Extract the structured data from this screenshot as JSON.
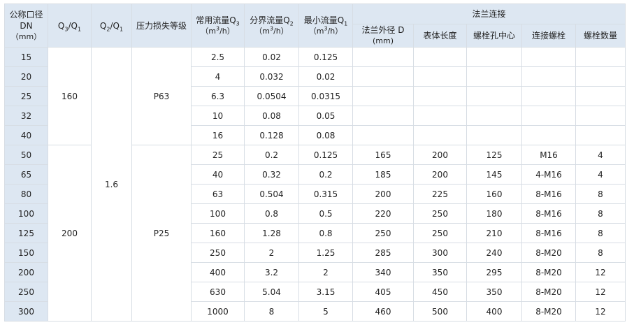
{
  "headers": {
    "dn": "公称口径",
    "dn_sub": "DN",
    "dn_unit": "（mm）",
    "q3q1_a": "Q",
    "q3q1_s1": "3",
    "q3q1_slash": "/Q",
    "q3q1_s2": "1",
    "q2q1_a": "Q",
    "q2q1_s1": "2",
    "q2q1_slash": "/Q",
    "q2q1_s2": "1",
    "pressure_loss": "压力损失等级",
    "q3_label": "常用流量Q",
    "q3_sub": "3",
    "q2_label": "分界流量Q",
    "q2_sub": "2",
    "q1_label": "最小流量Q",
    "q1_sub": "1",
    "flow_unit_pre": "（m",
    "flow_unit_sup": "3",
    "flow_unit_post": "/h）",
    "flange_group": "法兰连接",
    "flange_od": "法兰外径 D",
    "flange_od_unit": "(mm)",
    "body_length": "表体长度",
    "bolt_hole_center": "螺栓孔中心",
    "bolt": "连接螺栓",
    "bolt_count": "螺栓数量"
  },
  "merged": {
    "q3q1_p63": "160",
    "q3q1_p25": "200",
    "q2q1_all": "1.6",
    "loss_p63": "P63",
    "loss_p25": "P25"
  },
  "rows": [
    {
      "dn": "15",
      "q3": "2.5",
      "q2": "0.02",
      "q1": "0.125",
      "od": "",
      "len": "",
      "center": "",
      "bolt": "",
      "count": ""
    },
    {
      "dn": "20",
      "q3": "4",
      "q2": "0.032",
      "q1": "0.02",
      "od": "",
      "len": "",
      "center": "",
      "bolt": "",
      "count": ""
    },
    {
      "dn": "25",
      "q3": "6.3",
      "q2": "0.0504",
      "q1": "0.0315",
      "od": "",
      "len": "",
      "center": "",
      "bolt": "",
      "count": ""
    },
    {
      "dn": "32",
      "q3": "10",
      "q2": "0.08",
      "q1": "0.05",
      "od": "",
      "len": "",
      "center": "",
      "bolt": "",
      "count": ""
    },
    {
      "dn": "40",
      "q3": "16",
      "q2": "0.128",
      "q1": "0.08",
      "od": "",
      "len": "",
      "center": "",
      "bolt": "",
      "count": ""
    },
    {
      "dn": "50",
      "q3": "25",
      "q2": "0.2",
      "q1": "0.125",
      "od": "165",
      "len": "200",
      "center": "125",
      "bolt": "M16",
      "count": "4"
    },
    {
      "dn": "65",
      "q3": "40",
      "q2": "0.32",
      "q1": "0.2",
      "od": "185",
      "len": "200",
      "center": "145",
      "bolt": "4-M16",
      "count": "4"
    },
    {
      "dn": "80",
      "q3": "63",
      "q2": "0.504",
      "q1": "0.315",
      "od": "200",
      "len": "225",
      "center": "160",
      "bolt": "8-M16",
      "count": "8"
    },
    {
      "dn": "100",
      "q3": "100",
      "q2": "0.8",
      "q1": "0.5",
      "od": "220",
      "len": "250",
      "center": "180",
      "bolt": "8-M16",
      "count": "8"
    },
    {
      "dn": "125",
      "q3": "160",
      "q2": "1.28",
      "q1": "0.8",
      "od": "250",
      "len": "250",
      "center": "210",
      "bolt": "8-M16",
      "count": "8"
    },
    {
      "dn": "150",
      "q3": "250",
      "q2": "2",
      "q1": "1.25",
      "od": "285",
      "len": "300",
      "center": "240",
      "bolt": "8-M20",
      "count": "8"
    },
    {
      "dn": "200",
      "q3": "400",
      "q2": "3.2",
      "q1": "2",
      "od": "340",
      "len": "350",
      "center": "295",
      "bolt": "8-M20",
      "count": "12"
    },
    {
      "dn": "250",
      "q3": "630",
      "q2": "5.04",
      "q1": "3.15",
      "od": "405",
      "len": "450",
      "center": "350",
      "bolt": "8-M20",
      "count": "12"
    },
    {
      "dn": "300",
      "q3": "1000",
      "q2": "8",
      "q1": "5",
      "od": "460",
      "len": "500",
      "center": "400",
      "bolt": "8-M20",
      "count": "12"
    }
  ],
  "colors": {
    "header_bg": "#dde7f2",
    "border": "#d7dde4",
    "text": "#222222"
  }
}
